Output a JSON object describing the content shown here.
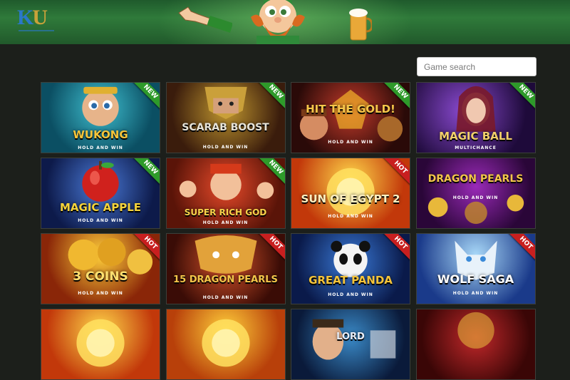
{
  "header": {
    "logo_k": "K",
    "logo_u": "U"
  },
  "search": {
    "placeholder": "Game search"
  },
  "colors": {
    "new_badge": "#2e9a2a",
    "hot_badge": "#c81f1f",
    "background": "#1c1f1b"
  },
  "games": [
    {
      "title": "WUKONG",
      "subtitle": "HOLD AND WIN",
      "badge": "NEW"
    },
    {
      "title": "SCARAB BOOST",
      "subtitle": "HOLD AND WIN",
      "badge": "NEW"
    },
    {
      "title": "HIT THE GOLD!",
      "subtitle": "HOLD AND WIN",
      "badge": "NEW"
    },
    {
      "title": "MAGIC BALL",
      "subtitle": "MULTICHANCE",
      "badge": "NEW"
    },
    {
      "title": "MAGIC APPLE",
      "subtitle": "HOLD AND WIN",
      "badge": "NEW"
    },
    {
      "title": "SUPER RICH GOD",
      "subtitle": "HOLD AND WIN",
      "badge": "NEW"
    },
    {
      "title": "SUN OF EGYPT 2",
      "subtitle": "HOLD AND WIN",
      "badge": "HOT"
    },
    {
      "title": "DRAGON PEARLS",
      "subtitle": "HOLD AND WIN",
      "badge": ""
    },
    {
      "title": "3 COINS",
      "subtitle": "HOLD AND WIN",
      "badge": "HOT"
    },
    {
      "title": "15 DRAGON PEARLS",
      "subtitle": "HOLD AND WIN",
      "badge": "HOT"
    },
    {
      "title": "GREAT PANDA",
      "subtitle": "HOLD AND WIN",
      "badge": "HOT"
    },
    {
      "title": "WOLF SAGA",
      "subtitle": "HOLD AND WIN",
      "badge": "HOT"
    },
    {
      "title": "",
      "subtitle": "",
      "badge": ""
    },
    {
      "title": "",
      "subtitle": "",
      "badge": ""
    },
    {
      "title": "LORD",
      "subtitle": "",
      "badge": ""
    },
    {
      "title": "",
      "subtitle": "",
      "badge": ""
    }
  ]
}
